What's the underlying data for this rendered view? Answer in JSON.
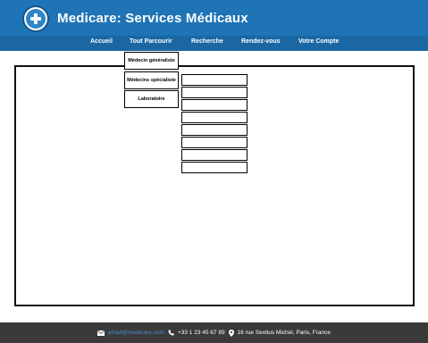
{
  "header": {
    "title": "Medicare: Services Médicaux",
    "logo_icon": "medical-cross-icon",
    "brand_color": "#1f74b5"
  },
  "nav": {
    "items": [
      "Accueil",
      "Tout Parcourir",
      "Recherche",
      "Rendez-vous",
      "Votre Compte"
    ]
  },
  "dropdown": {
    "items": [
      "Médecin généraliste",
      "Médecins spécialiste",
      "Laboratoire"
    ]
  },
  "footer": {
    "email": "email@medicare.com",
    "phone": "+33 1 23 45 67 89",
    "address": "16 rue Sextius Michel, Paris, France",
    "icons": [
      "envelope-icon",
      "phone-icon",
      "map-pin-icon"
    ],
    "background_color": "#3a3a3a"
  }
}
